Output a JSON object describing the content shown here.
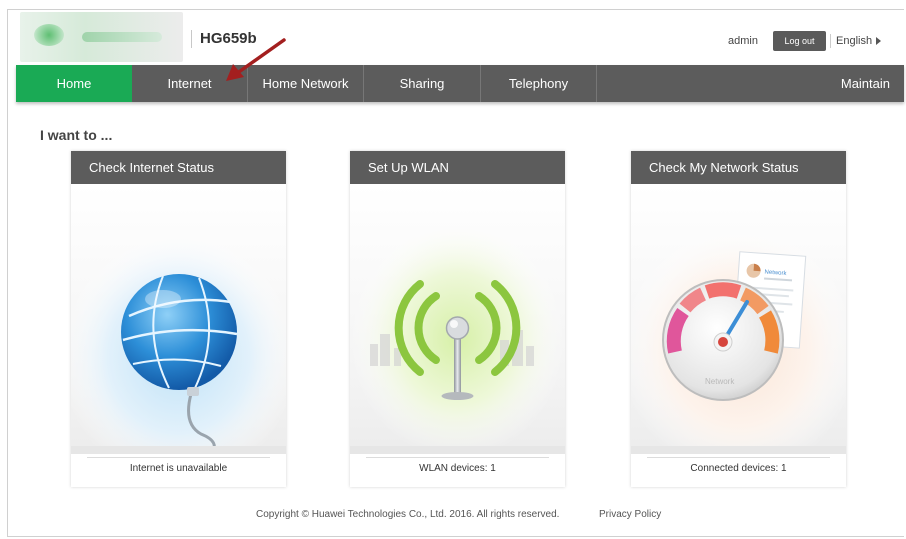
{
  "header": {
    "model": "HG659b",
    "user": "admin",
    "logout_label": "Log out",
    "language": "English"
  },
  "nav": {
    "items": [
      {
        "label": "Home",
        "active": true
      },
      {
        "label": "Internet"
      },
      {
        "label": "Home Network"
      },
      {
        "label": "Sharing"
      },
      {
        "label": "Telephony"
      },
      {
        "label": "Maintain"
      }
    ],
    "active_color": "#1aaa55",
    "bar_color": "#5c5c5c"
  },
  "main": {
    "heading": "I want to ...",
    "cards": [
      {
        "title": "Check Internet Status",
        "status": "Internet is unavailable",
        "icon": "globe-icon"
      },
      {
        "title": "Set Up WLAN",
        "status": "WLAN devices: 1",
        "icon": "wifi-antenna-icon"
      },
      {
        "title": "Check My Network Status",
        "status": "Connected devices: 1",
        "icon": "network-gauge-icon",
        "icon_texts": {
          "document_title": "Network",
          "gauge_label": "Network"
        }
      }
    ]
  },
  "footer": {
    "copyright": "Copyright © Huawei Technologies Co., Ltd. 2016. All rights reserved.",
    "privacy": "Privacy Policy"
  },
  "annotation": {
    "arrow_color": "#a31f1f",
    "points_to": "Internet"
  }
}
